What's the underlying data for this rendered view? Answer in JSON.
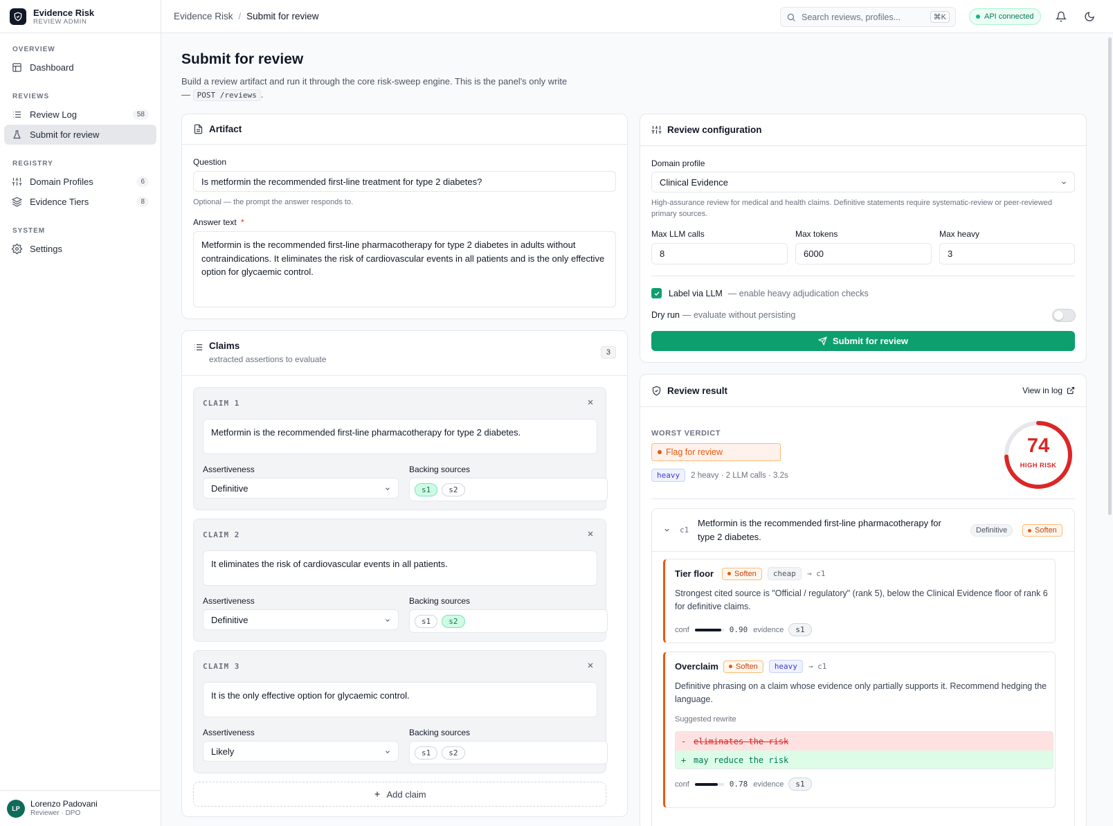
{
  "brand": {
    "name": "Evidence Risk",
    "sub": "REVIEW ADMIN"
  },
  "nav": {
    "sections": [
      {
        "title": "OVERVIEW",
        "items": [
          {
            "label": "Dashboard"
          }
        ]
      },
      {
        "title": "REVIEWS",
        "items": [
          {
            "label": "Review Log",
            "count": "58"
          },
          {
            "label": "Submit for review"
          }
        ]
      },
      {
        "title": "REGISTRY",
        "items": [
          {
            "label": "Domain Profiles",
            "count": "6"
          },
          {
            "label": "Evidence Tiers",
            "count": "8"
          }
        ]
      },
      {
        "title": "SYSTEM",
        "items": [
          {
            "label": "Settings"
          }
        ]
      }
    ]
  },
  "user": {
    "initials": "LP",
    "name": "Lorenzo Padovani",
    "role": "Reviewer · DPO"
  },
  "topbar": {
    "crumb_root": "Evidence Risk",
    "crumb_sep": "/",
    "crumb_current": "Submit for review",
    "search_placeholder": "Search reviews, profiles...",
    "search_shortcut": "⌘K",
    "api_status": "API connected"
  },
  "page": {
    "title": "Submit for review",
    "desc_pre": "Build a review artifact and run it through the core risk-sweep engine. This is the panel's only write —",
    "desc_code": "POST /reviews",
    "desc_post": "."
  },
  "artifact": {
    "title": "Artifact",
    "question_label": "Question",
    "question_value": "Is metformin the recommended first-line treatment for type 2 diabetes?",
    "question_help": "Optional — the prompt the answer responds to.",
    "answer_label": "Answer text",
    "answer_required": "*",
    "answer_value": "Metformin is the recommended first-line pharmacotherapy for type 2 diabetes in adults without contraindications. It eliminates the risk of cardiovascular events in all patients and is the only effective option for glycaemic control."
  },
  "claims": {
    "title": "Claims",
    "subtitle": "extracted assertions to evaluate",
    "count": "3",
    "assert_label": "Assertiveness",
    "sources_label": "Backing sources",
    "items": [
      {
        "label": "CLAIM 1",
        "text": "Metformin is the recommended first-line pharmacotherapy for type 2 diabetes.",
        "assertiveness": "Definitive",
        "s1": "s1",
        "s2": "s2"
      },
      {
        "label": "CLAIM 2",
        "text": "It eliminates the risk of cardiovascular events in all patients.",
        "assertiveness": "Definitive",
        "s1": "s1",
        "s2": "s2"
      },
      {
        "label": "CLAIM 3",
        "text": "It is the only effective option for glycaemic control.",
        "assertiveness": "Likely",
        "s1": "s1",
        "s2": "s2"
      }
    ],
    "add_label": "Add claim"
  },
  "config": {
    "title": "Review configuration",
    "profile_label": "Domain profile",
    "profile_value": "Clinical Evidence",
    "profile_help": "High-assurance review for medical and health claims. Definitive statements require systematic-review or peer-reviewed primary sources.",
    "max_calls_label": "Max LLM calls",
    "max_calls": "8",
    "max_tokens_label": "Max tokens",
    "max_tokens": "6000",
    "max_heavy_label": "Max heavy",
    "max_heavy": "3",
    "llm_label": "Label via LLM",
    "llm_hint": "— enable heavy adjudication checks",
    "dry_label": "Dry run",
    "dry_hint": "— evaluate without persisting",
    "submit_label": "Submit for review"
  },
  "result": {
    "title": "Review result",
    "view_log": "View in log",
    "worst_label": "WORST VERDICT",
    "verdict": "Flag for review",
    "tier": "heavy",
    "meta": "2 heavy · 2 LLM calls · 3.2s",
    "score": 74,
    "score_max": 100,
    "score_label": "HIGH RISK",
    "claim_id": "c1",
    "claim_text": "Metformin is the recommended first-line pharmacotherapy for type 2 diabetes.",
    "claim_assert": "Definitive",
    "claim_verdict": "Soften",
    "findings": [
      {
        "title": "Tier floor",
        "verdict": "Soften",
        "tier": "cheap",
        "target": "→ c1",
        "body": "Strongest cited source is \"Official / regulatory\" (rank 5), below the Clinical Evidence floor of rank 6 for definitive claims.",
        "conf_label": "conf",
        "conf": "0.90",
        "evidence_label": "evidence",
        "evidence": "s1"
      },
      {
        "title": "Overclaim",
        "verdict": "Soften",
        "tier": "heavy",
        "target": "→ c1",
        "body": "Definitive phrasing on a claim whose evidence only partially supports it. Recommend hedging the language.",
        "rewrite_label": "Suggested rewrite",
        "minus": "-",
        "removed": "eliminates the risk",
        "plus": "+",
        "added": "may reduce the risk",
        "conf_label": "conf",
        "conf": "0.78",
        "evidence_label": "evidence",
        "evidence": "s1"
      }
    ]
  },
  "colors": {
    "accent": "#0e9f6e",
    "risk": "#dc2626",
    "soften": "#ea580c"
  }
}
